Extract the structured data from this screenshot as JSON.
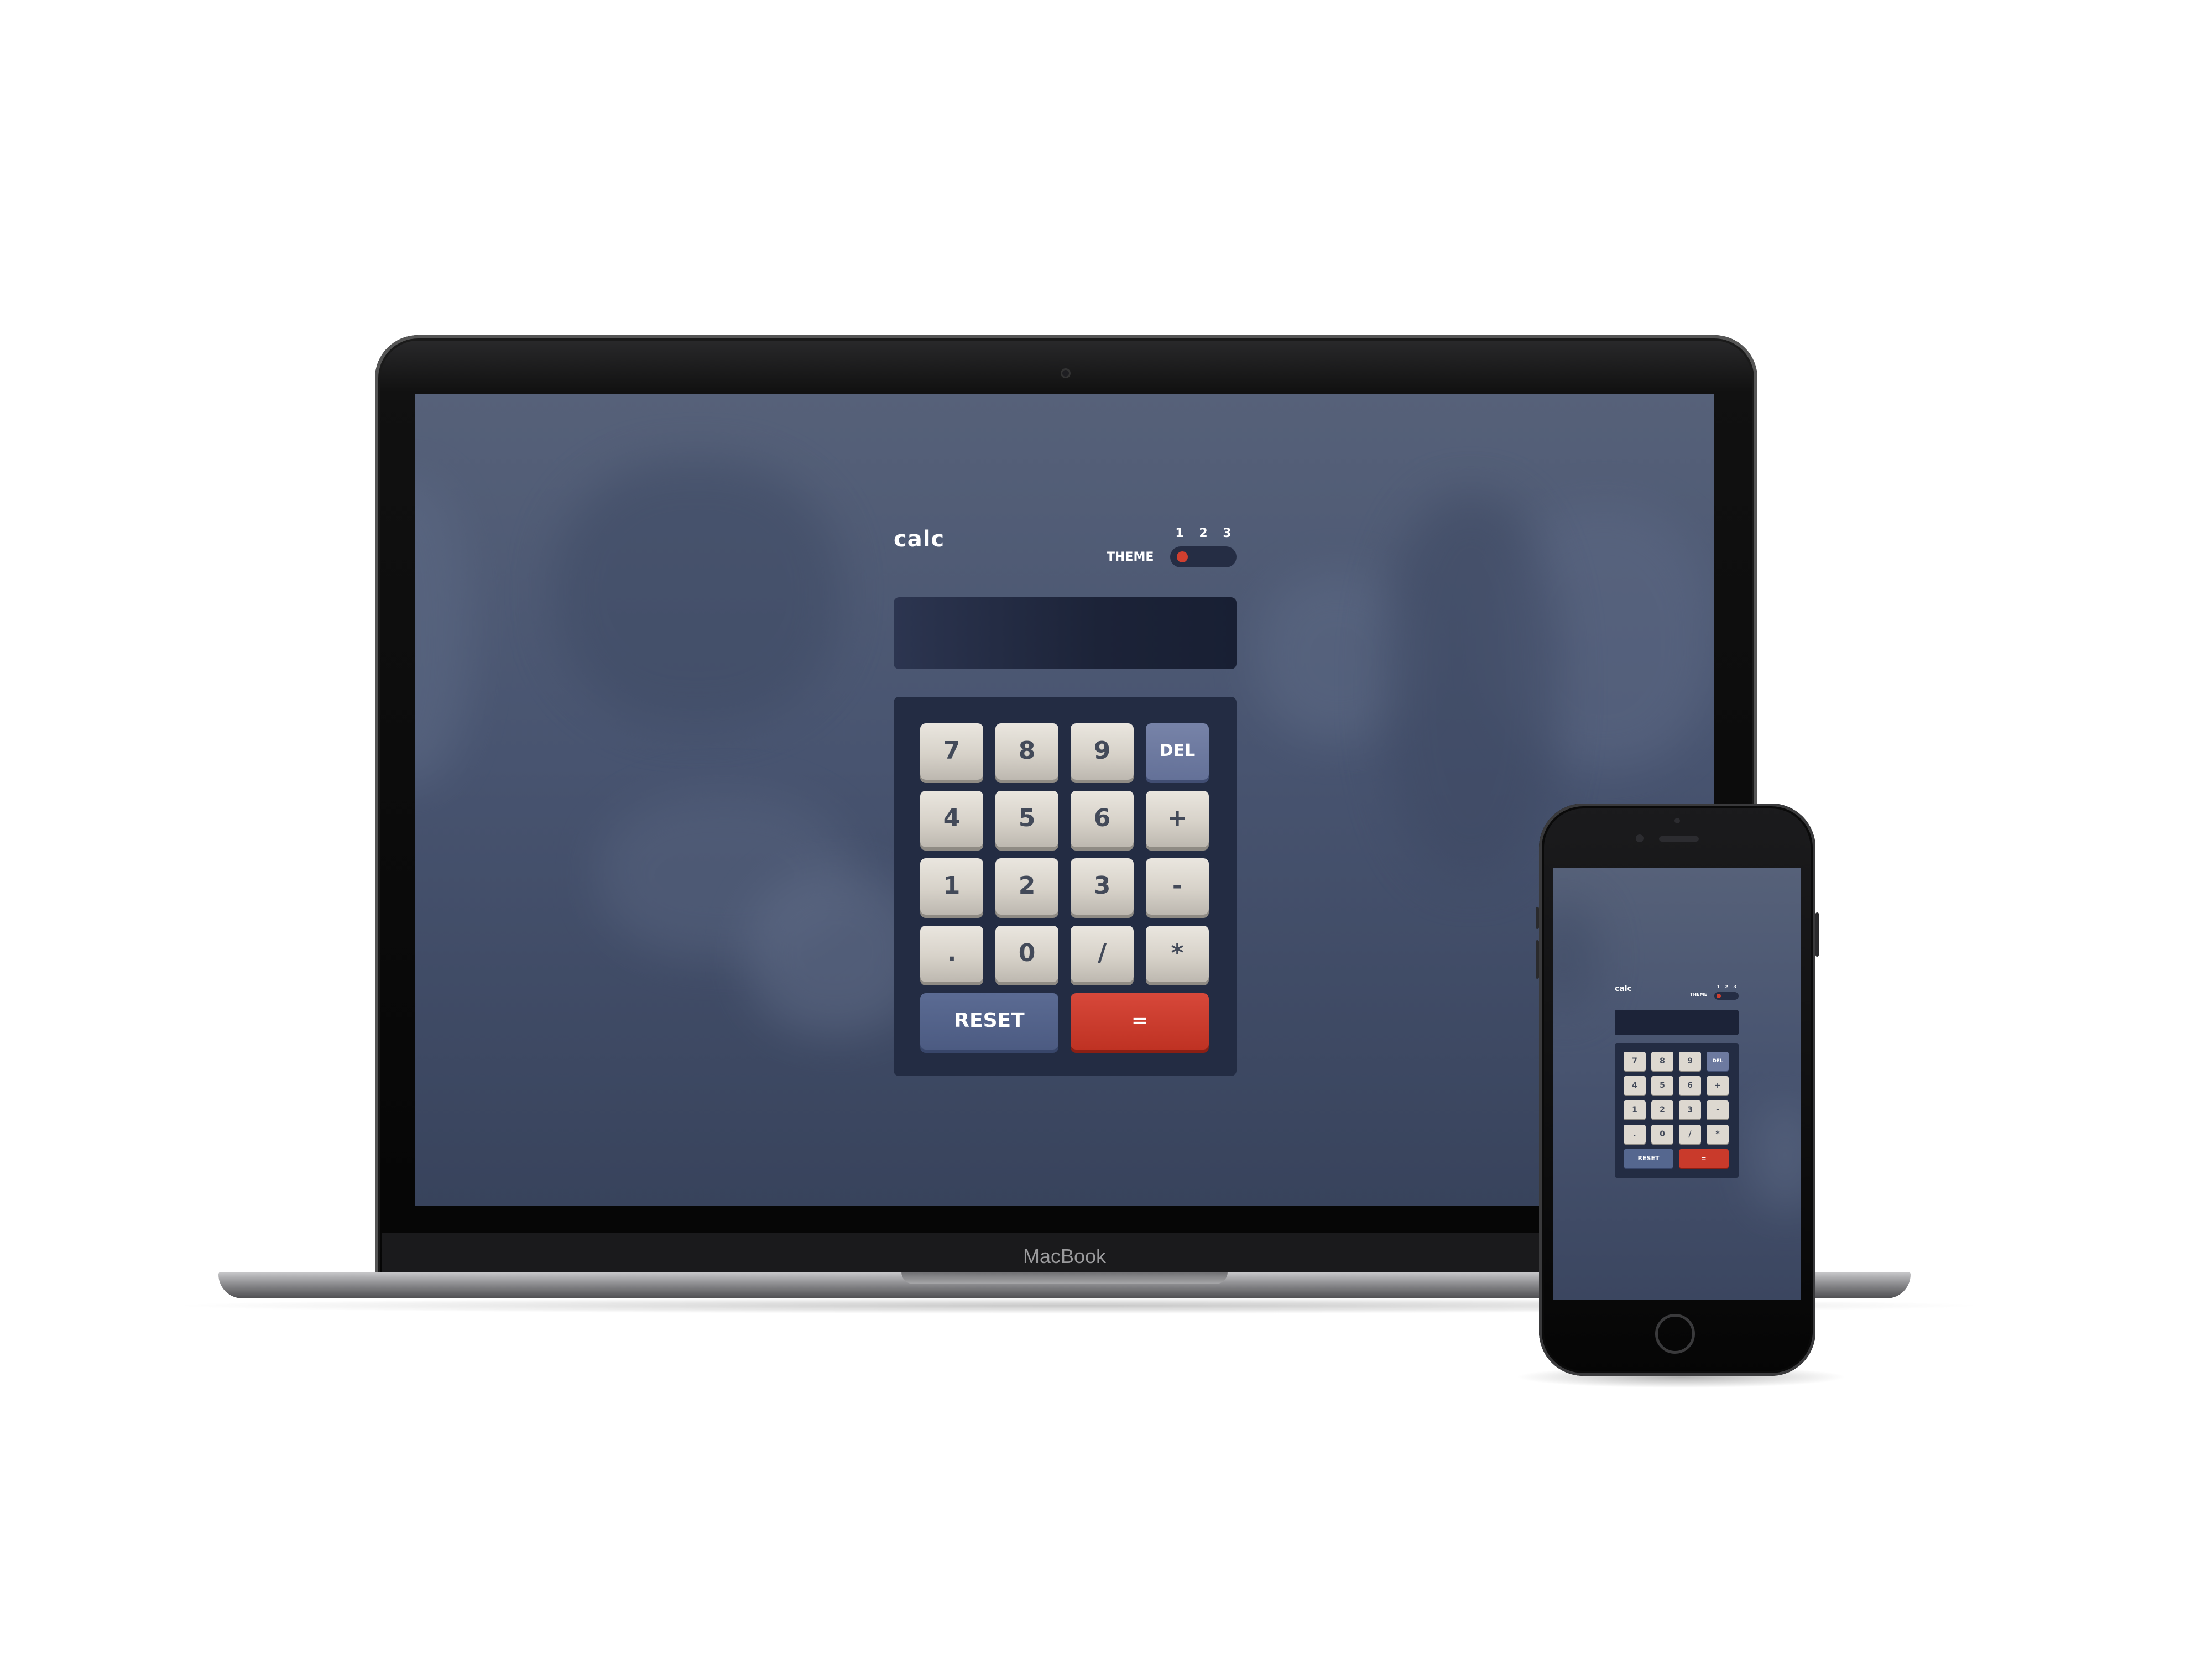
{
  "app": {
    "logo": "calc",
    "theme_label": "THEME",
    "theme_options": [
      "1",
      "2",
      "3"
    ],
    "selected_theme": "1",
    "display_value": ""
  },
  "keypad": {
    "k7": "7",
    "k8": "8",
    "k9": "9",
    "del": "DEL",
    "k4": "4",
    "k5": "5",
    "k6": "6",
    "plus": "+",
    "k1": "1",
    "k2": "2",
    "k3": "3",
    "minus": "-",
    "dot": ".",
    "k0": "0",
    "divide": "/",
    "multiply": "*",
    "reset": "RESET",
    "equals": "="
  },
  "device": {
    "laptop_brand": "MacBook"
  },
  "colors": {
    "background": "#485470",
    "keypad": "#232c43",
    "display": "#1c2338",
    "key": "#d7d2c9",
    "del_key": "#647198",
    "reset_key": "#4c5b82",
    "equals_key": "#bf3223",
    "toggle_knob": "#d03f2f"
  }
}
